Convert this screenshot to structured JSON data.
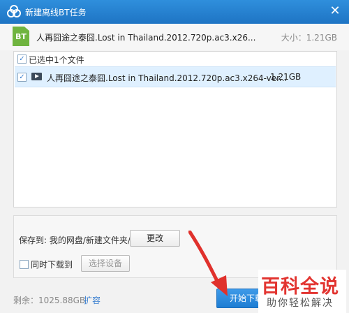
{
  "window": {
    "title": "新建离线BT任务",
    "close_glyph": "✕"
  },
  "header": {
    "icon_text": "BT",
    "file_name": "人再囧途之泰囧.Lost in Thailand.2012.720p.ac3.x26...",
    "size_label": "大小：1.21GB"
  },
  "file_list": {
    "selected_summary": "已选中1个文件",
    "rows": [
      {
        "name": "人再囧途之泰囧.Lost in Thailand.2012.720p.ac3.x264-ver...",
        "size": "1.21GB",
        "checked": true
      }
    ]
  },
  "save": {
    "label": "保存到: 我的网盘/新建文件夹/",
    "change_button": "更改",
    "sync_download_label": "同时下载到",
    "select_device_button": "选择设备"
  },
  "footer": {
    "remaining": "剩余：1025.88GB",
    "expand_link": "扩容",
    "start_button": "开始下载"
  },
  "watermark": {
    "title": "百科全说",
    "subtitle": "助你轻松解决"
  },
  "colors": {
    "title_bar": "#1e74c4",
    "accent": "#3a7fd0",
    "arrow": "#e0312c",
    "bt_icon": "#6fb43f"
  }
}
